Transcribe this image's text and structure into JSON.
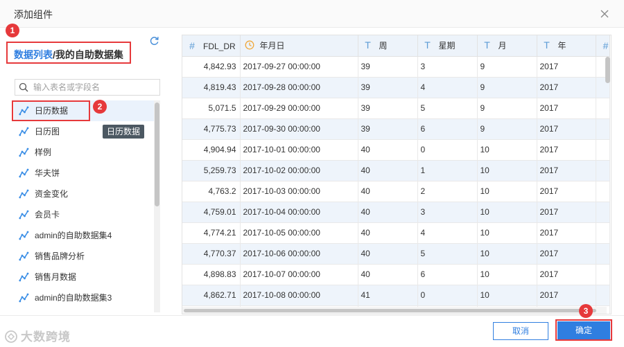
{
  "dialog": {
    "title": "添加组件"
  },
  "path": {
    "root": "数据列表",
    "separator": "/",
    "current": "我的自助数据集"
  },
  "search": {
    "placeholder": "输入表名或字段名",
    "value": ""
  },
  "datasets": [
    {
      "label": "日历数据",
      "selected": true
    },
    {
      "label": "日历图",
      "selected": false
    },
    {
      "label": "样例",
      "selected": false
    },
    {
      "label": "华夫饼",
      "selected": false
    },
    {
      "label": "资金变化",
      "selected": false
    },
    {
      "label": "会员卡",
      "selected": false
    },
    {
      "label": "admin的自助数据集4",
      "selected": false
    },
    {
      "label": "销售品牌分析",
      "selected": false
    },
    {
      "label": "销售月数据",
      "selected": false
    },
    {
      "label": "admin的自助数据集3",
      "selected": false
    }
  ],
  "tooltip": "日历数据",
  "badges": [
    "1",
    "2",
    "3"
  ],
  "table": {
    "columns": [
      {
        "name": "FDL_DR",
        "type_icon": "#"
      },
      {
        "name": "年月日",
        "type_icon": "clock-icon"
      },
      {
        "name": "周",
        "type_icon": "T"
      },
      {
        "name": "星期",
        "type_icon": "T"
      },
      {
        "name": "月",
        "type_icon": "T"
      },
      {
        "name": "年",
        "type_icon": "T"
      },
      {
        "name": "",
        "type_icon": "#"
      }
    ],
    "rows": [
      [
        "4,842.93",
        "2017-09-27 00:00:00",
        "39",
        "3",
        "9",
        "2017"
      ],
      [
        "4,819.43",
        "2017-09-28 00:00:00",
        "39",
        "4",
        "9",
        "2017"
      ],
      [
        "5,071.5",
        "2017-09-29 00:00:00",
        "39",
        "5",
        "9",
        "2017"
      ],
      [
        "4,775.73",
        "2017-09-30 00:00:00",
        "39",
        "6",
        "9",
        "2017"
      ],
      [
        "4,904.94",
        "2017-10-01 00:00:00",
        "40",
        "0",
        "10",
        "2017"
      ],
      [
        "5,259.73",
        "2017-10-02 00:00:00",
        "40",
        "1",
        "10",
        "2017"
      ],
      [
        "4,763.2",
        "2017-10-03 00:00:00",
        "40",
        "2",
        "10",
        "2017"
      ],
      [
        "4,759.01",
        "2017-10-04 00:00:00",
        "40",
        "3",
        "10",
        "2017"
      ],
      [
        "4,774.21",
        "2017-10-05 00:00:00",
        "40",
        "4",
        "10",
        "2017"
      ],
      [
        "4,770.37",
        "2017-10-06 00:00:00",
        "40",
        "5",
        "10",
        "2017"
      ],
      [
        "4,898.83",
        "2017-10-07 00:00:00",
        "40",
        "6",
        "10",
        "2017"
      ],
      [
        "4,862.71",
        "2017-10-08 00:00:00",
        "41",
        "0",
        "10",
        "2017"
      ],
      [
        "",
        "",
        "",
        "",
        "",
        ""
      ]
    ]
  },
  "footer": {
    "cancel_label": "取消",
    "ok_label": "确定"
  },
  "watermark": "大数跨境",
  "colors": {
    "accent": "#2f7ee0",
    "highlight": "#e6393b",
    "row_alt": "#eef4fb",
    "header_bg": "#edf3fa"
  }
}
